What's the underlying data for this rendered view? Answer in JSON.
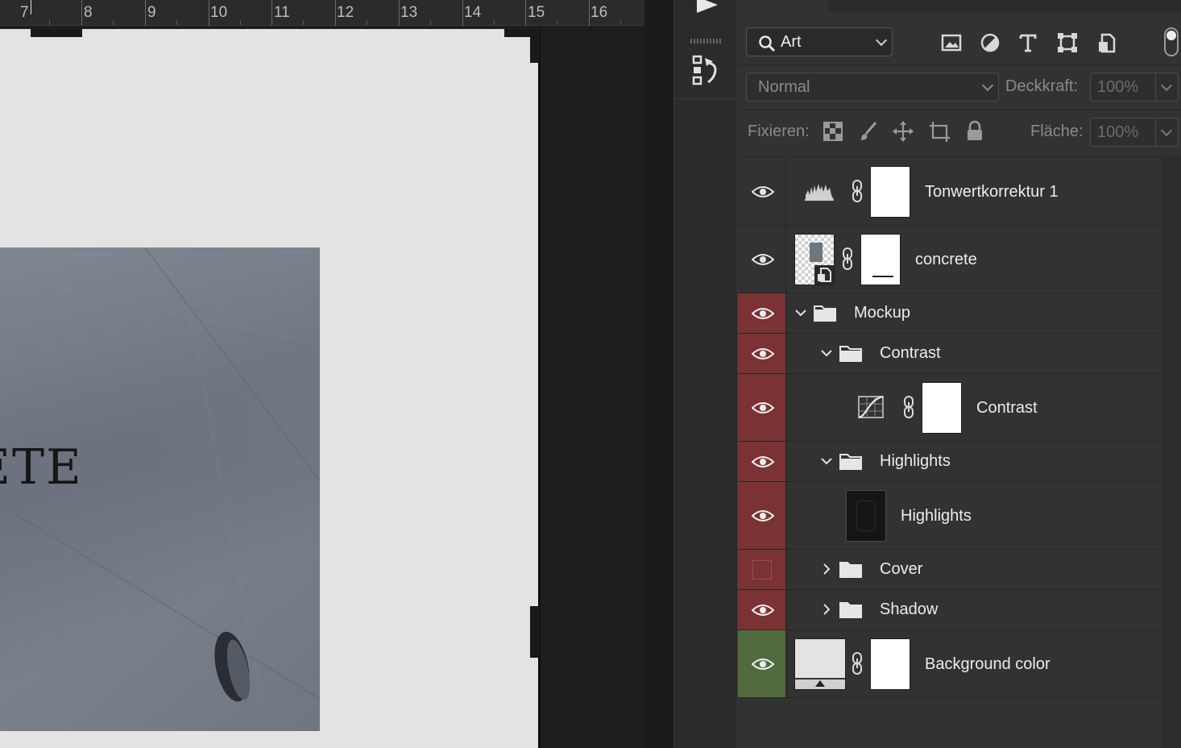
{
  "ruler": {
    "labels": [
      "7",
      "8",
      "9",
      "10",
      "11",
      "12",
      "13",
      "14",
      "15",
      "16"
    ]
  },
  "document": {
    "cover_title": "RETE"
  },
  "filter": {
    "kind_label": "Art",
    "icons": [
      "image-filter-icon",
      "adjustment-filter-icon",
      "type-filter-icon",
      "shape-filter-icon",
      "smart-object-filter-icon"
    ]
  },
  "blend": {
    "mode": "Normal",
    "opacity_label": "Deckkraft:",
    "opacity_value": "100%"
  },
  "lock": {
    "label": "Fixieren:",
    "fill_label": "Fläche:",
    "fill_value": "100%",
    "icons": [
      "lock-transparent-pixels-icon",
      "lock-image-pixels-icon",
      "lock-position-icon",
      "lock-artboard-icon",
      "lock-all-icon"
    ]
  },
  "layers": [
    {
      "name": "Tonwertkorrektur 1",
      "type": "levels-adjustment",
      "visible": true,
      "color": "none"
    },
    {
      "name": "concrete",
      "type": "smart-object",
      "visible": true,
      "color": "none"
    },
    {
      "name": "Mockup",
      "type": "group",
      "expanded": true,
      "visible": true,
      "color": "#7b3234"
    },
    {
      "name": "Contrast",
      "type": "group",
      "expanded": true,
      "visible": true,
      "color": "#7b3234"
    },
    {
      "name": "Contrast",
      "type": "curves-adjustment",
      "visible": true,
      "color": "#7b3234"
    },
    {
      "name": "Highlights",
      "type": "group",
      "expanded": true,
      "visible": true,
      "color": "#7b3234"
    },
    {
      "name": "Highlights",
      "type": "pixel-layer",
      "visible": true,
      "color": "#7b3234"
    },
    {
      "name": "Cover",
      "type": "group",
      "expanded": false,
      "visible": false,
      "color": "#7b3234"
    },
    {
      "name": "Shadow",
      "type": "group",
      "expanded": false,
      "visible": true,
      "color": "#7b3234"
    },
    {
      "name": "Background color",
      "type": "fill-layer",
      "visible": true,
      "color": "#526b3e"
    }
  ]
}
